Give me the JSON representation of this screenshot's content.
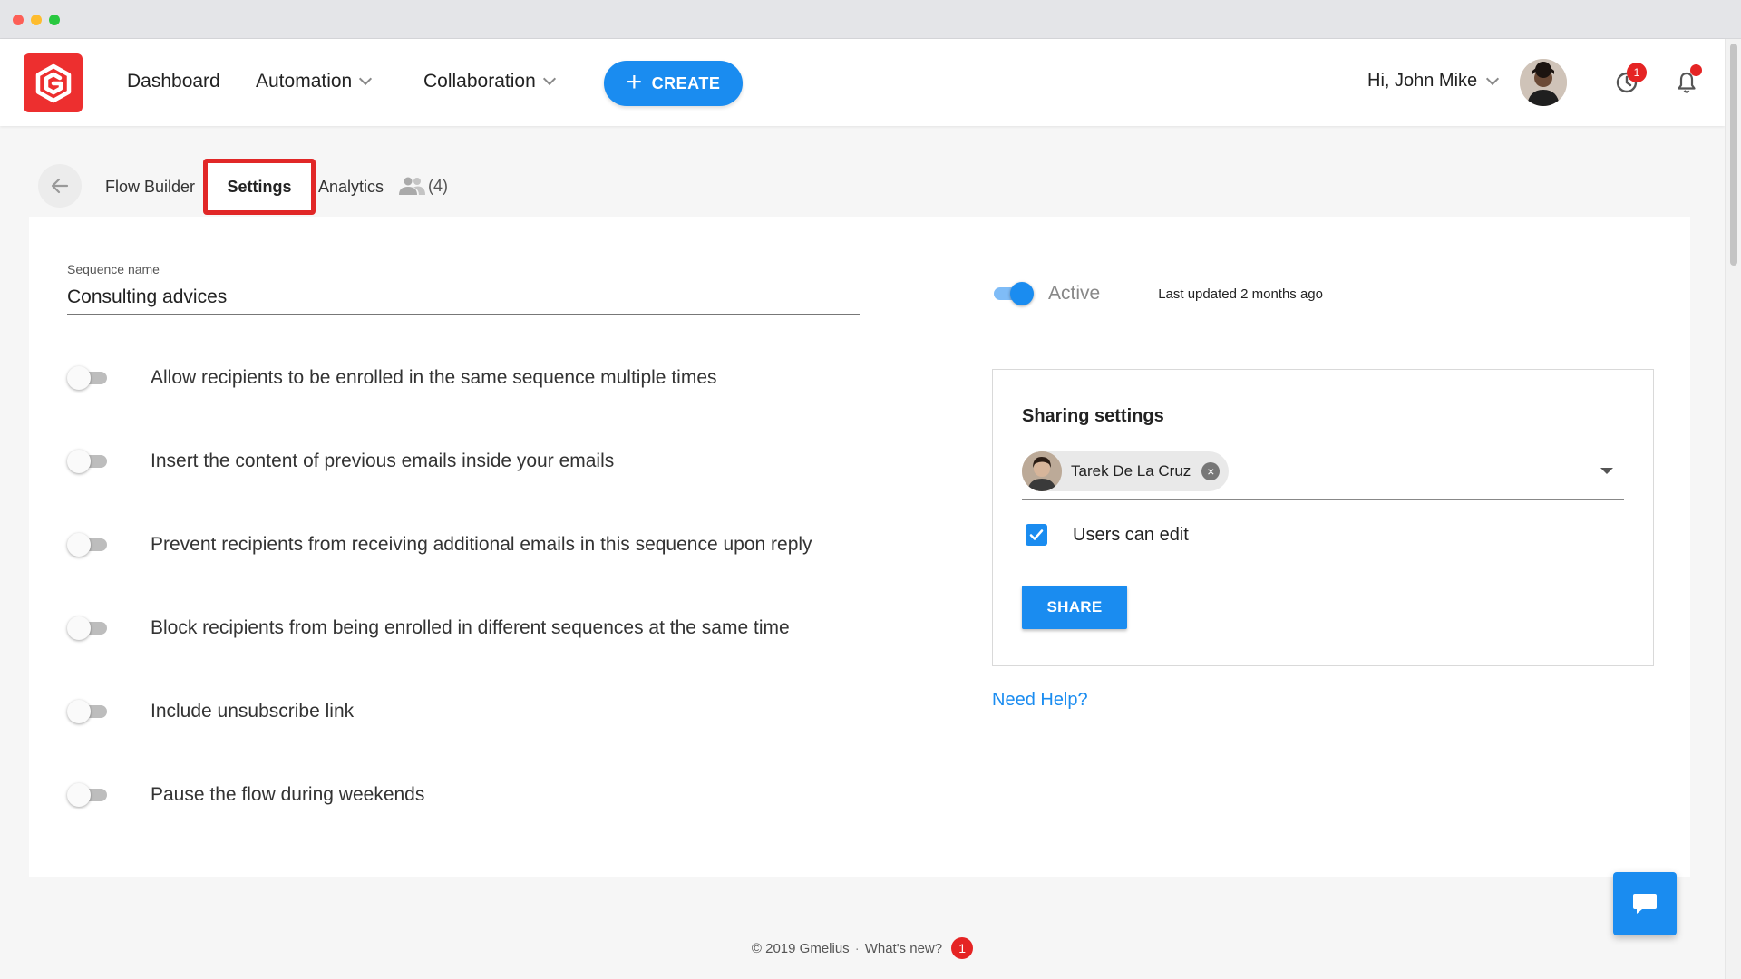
{
  "nav": {
    "dashboard": "Dashboard",
    "automation": "Automation",
    "collaboration": "Collaboration",
    "create": "CREATE",
    "greeting": "Hi, John Mike",
    "history_badge": "1"
  },
  "tabs": {
    "flow_builder": "Flow Builder",
    "settings": "Settings",
    "analytics": "Analytics",
    "members_count": "(4)"
  },
  "sequence": {
    "name_label": "Sequence name",
    "name_value": "Consulting advices"
  },
  "options": [
    {
      "label": "Allow recipients to be enrolled in the same sequence multiple times",
      "enabled": false
    },
    {
      "label": "Insert the content of previous emails inside your emails",
      "enabled": false
    },
    {
      "label": "Prevent recipients from receiving additional emails in this sequence upon reply",
      "enabled": false
    },
    {
      "label": "Block recipients from being enrolled in different sequences at the same time",
      "enabled": false
    },
    {
      "label": "Include unsubscribe link",
      "enabled": false
    },
    {
      "label": "Pause the flow during weekends",
      "enabled": false
    }
  ],
  "status": {
    "active_label": "Active",
    "active": true,
    "last_updated": "Last updated 2 months ago"
  },
  "sharing": {
    "title": "Sharing settings",
    "user_chip": "Tarek De La Cruz",
    "users_can_edit_label": "Users can edit",
    "users_can_edit": true,
    "share_button": "SHARE"
  },
  "help": {
    "link": "Need Help?"
  },
  "footer": {
    "copyright": "© 2019 Gmelius",
    "separator": "·",
    "whats_new": "What's new?",
    "badge": "1"
  },
  "colors": {
    "accent": "#1a8cf0",
    "brand": "#ed2f2f",
    "highlight_border": "#e12727",
    "badge": "#e52424"
  }
}
